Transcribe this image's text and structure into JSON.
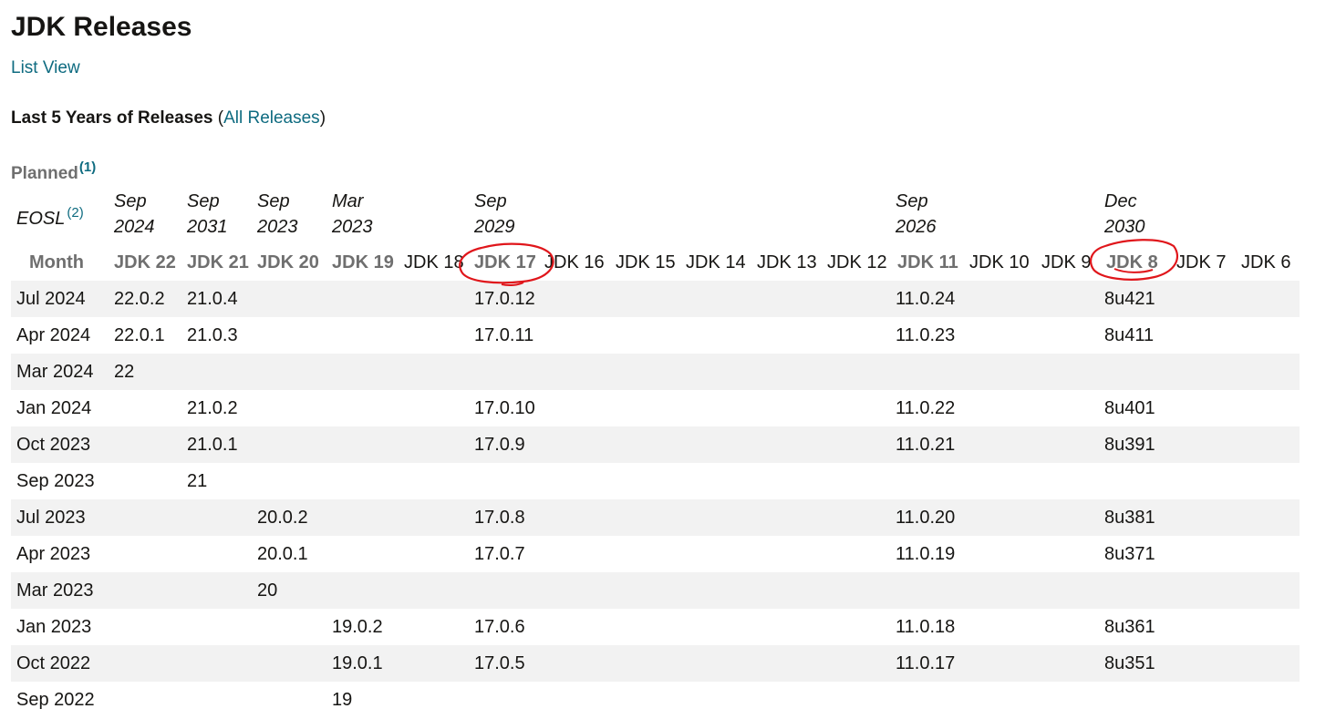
{
  "page": {
    "title": "JDK Releases",
    "list_view_link": "List View"
  },
  "section": {
    "heading": "Last 5 Years of Releases",
    "all_releases_link": "All Releases",
    "open_paren": "(",
    "close_paren": ")"
  },
  "planned": {
    "label": "Planned",
    "footnote": "(1)"
  },
  "eosl": {
    "label": "EOSL",
    "footnote": "(2)",
    "dates": {
      "jdk22": "Sep\n2024",
      "jdk21": "Sep\n2031",
      "jdk20": "Sep\n2023",
      "jdk19": "Mar\n2023",
      "jdk17": "Sep\n2029",
      "jdk11": "Sep\n2026",
      "jdk8": "Dec\n2030"
    }
  },
  "table": {
    "month_header": "Month",
    "columns": {
      "jdk22": "JDK 22",
      "jdk21": "JDK 21",
      "jdk20": "JDK 20",
      "jdk19": "JDK 19",
      "jdk18": "JDK 18",
      "jdk17": "JDK 17",
      "jdk16": "JDK 16",
      "jdk15": "JDK 15",
      "jdk14": "JDK 14",
      "jdk13": "JDK 13",
      "jdk12": "JDK 12",
      "jdk11": "JDK 11",
      "jdk10": "JDK 10",
      "jdk9": "JDK 9",
      "jdk8": "JDK 8",
      "jdk7": "JDK 7",
      "jdk6": "JDK 6"
    },
    "rows": [
      {
        "month": "Jul 2024",
        "jdk22": "22.0.2",
        "jdk21": "21.0.4",
        "jdk20": "",
        "jdk19": "",
        "jdk17": "17.0.12",
        "jdk11": "11.0.24",
        "jdk8": "8u421"
      },
      {
        "month": "Apr 2024",
        "jdk22": "22.0.1",
        "jdk21": "21.0.3",
        "jdk20": "",
        "jdk19": "",
        "jdk17": "17.0.11",
        "jdk11": "11.0.23",
        "jdk8": "8u411"
      },
      {
        "month": "Mar 2024",
        "jdk22": "22",
        "jdk21": "",
        "jdk20": "",
        "jdk19": "",
        "jdk17": "",
        "jdk11": "",
        "jdk8": ""
      },
      {
        "month": "Jan 2024",
        "jdk22": "",
        "jdk21": "21.0.2",
        "jdk20": "",
        "jdk19": "",
        "jdk17": "17.0.10",
        "jdk11": "11.0.22",
        "jdk8": "8u401"
      },
      {
        "month": "Oct 2023",
        "jdk22": "",
        "jdk21": "21.0.1",
        "jdk20": "",
        "jdk19": "",
        "jdk17": "17.0.9",
        "jdk11": "11.0.21",
        "jdk8": "8u391"
      },
      {
        "month": "Sep 2023",
        "jdk22": "",
        "jdk21": "21",
        "jdk20": "",
        "jdk19": "",
        "jdk17": "",
        "jdk11": "",
        "jdk8": ""
      },
      {
        "month": "Jul 2023",
        "jdk22": "",
        "jdk21": "",
        "jdk20": "20.0.2",
        "jdk19": "",
        "jdk17": "17.0.8",
        "jdk11": "11.0.20",
        "jdk8": "8u381"
      },
      {
        "month": "Apr 2023",
        "jdk22": "",
        "jdk21": "",
        "jdk20": "20.0.1",
        "jdk19": "",
        "jdk17": "17.0.7",
        "jdk11": "11.0.19",
        "jdk8": "8u371"
      },
      {
        "month": "Mar 2023",
        "jdk22": "",
        "jdk21": "",
        "jdk20": "20",
        "jdk19": "",
        "jdk17": "",
        "jdk11": "",
        "jdk8": ""
      },
      {
        "month": "Jan 2023",
        "jdk22": "",
        "jdk21": "",
        "jdk20": "",
        "jdk19": "19.0.2",
        "jdk17": "17.0.6",
        "jdk11": "11.0.18",
        "jdk8": "8u361"
      },
      {
        "month": "Oct 2022",
        "jdk22": "",
        "jdk21": "",
        "jdk20": "",
        "jdk19": "19.0.1",
        "jdk17": "17.0.5",
        "jdk11": "11.0.17",
        "jdk8": "8u351"
      },
      {
        "month": "Sep 2022",
        "jdk22": "",
        "jdk21": "",
        "jdk20": "",
        "jdk19": "19",
        "jdk17": "",
        "jdk11": "",
        "jdk8": ""
      }
    ]
  },
  "colors": {
    "link": "#0e6b80",
    "annotation": "#e0161b",
    "row_shade": "#f2f2f2",
    "header_gray": "#6f6f6f"
  }
}
